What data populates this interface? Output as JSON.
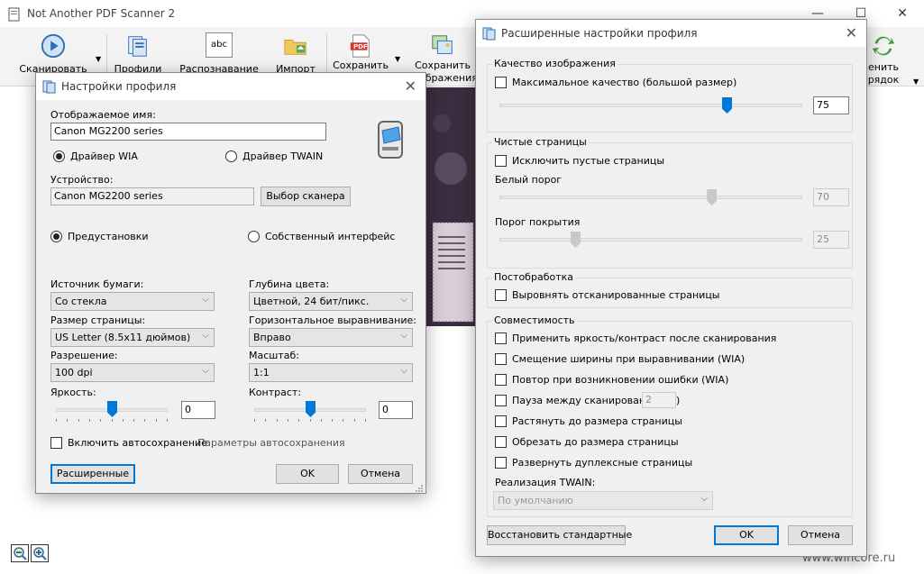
{
  "main_window": {
    "title": "Not Another PDF Scanner 2",
    "controls": {
      "minimize": "—",
      "maximize": "☐",
      "close": "✕"
    },
    "toolbar": {
      "scan": "Сканировать",
      "profiles": "Профили",
      "ocr": "Распознавание",
      "import": "Импорт",
      "save": "Сохранить",
      "save_images_line1": "Сохранить",
      "save_images_line2": "ображения",
      "reorder_line1": "енить",
      "reorder_line2": "рядок",
      "pdf_badge": "PDF",
      "ocr_badge": "abc"
    }
  },
  "profile_dialog": {
    "title": "Настройки профиля",
    "display_name_label": "Отображаемое имя:",
    "display_name_value": "Canon MG2200 series",
    "driver_wia": "Драйвер WIA",
    "driver_twain": "Драйвер TWAIN",
    "device_label": "Устройство:",
    "device_value": "Canon MG2200 series",
    "choose_scanner": "Выбор сканера",
    "presets": "Предустановки",
    "native_ui": "Собственный интерфейс",
    "paper_source_label": "Источник бумаги:",
    "paper_source_value": "Со стекла",
    "color_depth_label": "Глубина цвета:",
    "color_depth_value": "Цветной, 24 бит/пикс.",
    "page_size_label": "Размер страницы:",
    "page_size_value": "US Letter (8.5x11 дюймов)",
    "h_align_label": "Горизонтальное выравнивание:",
    "h_align_value": "Вправо",
    "resolution_label": "Разрешение:",
    "resolution_value": "100 dpi",
    "scale_label": "Масштаб:",
    "scale_value": "1:1",
    "brightness_label": "Яркость:",
    "brightness_value": "0",
    "brightness_level": 0.5,
    "contrast_label": "Контраст:",
    "contrast_value": "0",
    "contrast_level": 0.5,
    "autosave_label": "Включить автосохранение",
    "autosave_settings": "Параметры автосохранения",
    "advanced": "Расширенные",
    "ok": "OK",
    "cancel": "Отмена",
    "close": "✕"
  },
  "advanced_dialog": {
    "title": "Расширенные настройки профиля",
    "close": "✕",
    "image_quality_group": "Качество изображения",
    "max_quality": "Максимальное качество (большой размер)",
    "quality_value": "75",
    "quality_level": 0.75,
    "blank_pages_group": "Чистые страницы",
    "exclude_blank": "Исключить пустые страницы",
    "white_threshold_label": "Белый порог",
    "white_threshold_value": "70",
    "white_threshold_level": 0.7,
    "coverage_threshold_label": "Порог покрытия",
    "coverage_threshold_value": "25",
    "coverage_threshold_level": 0.25,
    "postprocessing_group": "Постобработка",
    "deskew": "Выровнять отсканированные страницы",
    "compat_group": "Совместимость",
    "compat_options": [
      "Применить яркость/контраст после сканирования",
      "Смещение ширины при выравнивании (WIA)",
      "Повтор при возникновении ошибки (WIA)",
      "Пауза между сканированиями",
      "Растянуть до размера страницы",
      "Обрезать до размера страницы",
      "Развернуть дуплексные страницы"
    ],
    "pause_value": "2",
    "pause_suffix": ")",
    "twain_impl_label": "Реализация TWAIN:",
    "twain_impl_value": "По умолчанию",
    "restore_defaults": "Восстановить стандартные",
    "ok": "OK",
    "cancel": "Отмена"
  },
  "watermark": "www.wincore.ru",
  "colors": {
    "accent": "#0078d7",
    "dialog_bg": "#f0f0f0",
    "toolbar_bg": "#f3f3f3"
  }
}
